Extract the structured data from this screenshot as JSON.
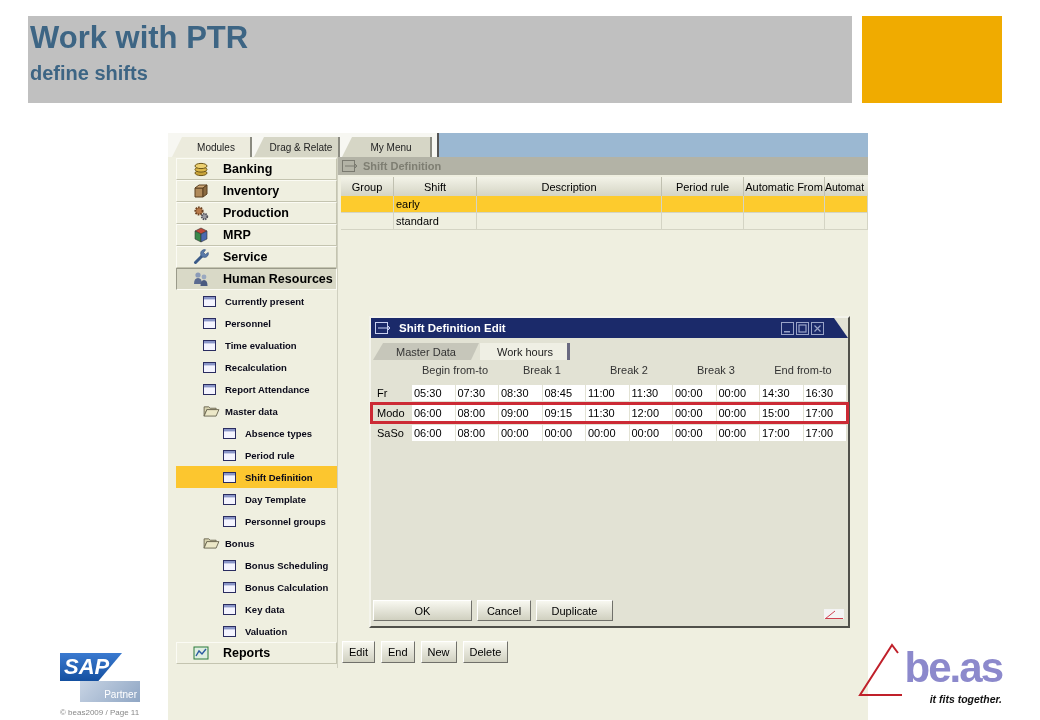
{
  "slide": {
    "title": "Work with PTR",
    "subtitle": "define shifts"
  },
  "sidebar": {
    "tabs": [
      {
        "label": "Modules",
        "selected": true
      },
      {
        "label": "Drag & Relate",
        "selected": false
      },
      {
        "label": "My Menu",
        "selected": false
      }
    ],
    "modules": [
      {
        "label": "Banking",
        "expanded": false
      },
      {
        "label": "Inventory",
        "expanded": false
      },
      {
        "label": "Production",
        "expanded": false
      },
      {
        "label": "MRP",
        "expanded": false
      },
      {
        "label": "Service",
        "expanded": false
      },
      {
        "label": "Human Resources",
        "expanded": true,
        "children": [
          {
            "label": "Currently present",
            "kind": "form",
            "selected": false
          },
          {
            "label": "Personnel",
            "kind": "form",
            "selected": false
          },
          {
            "label": "Time evaluation",
            "kind": "form",
            "selected": false
          },
          {
            "label": "Recalculation",
            "kind": "form",
            "selected": false
          },
          {
            "label": "Report Attendance",
            "kind": "form",
            "selected": false
          },
          {
            "label": "Master data",
            "kind": "folder",
            "selected": false,
            "expanded": true,
            "children": [
              {
                "label": "Absence types",
                "kind": "form",
                "selected": false
              },
              {
                "label": "Period rule",
                "kind": "form",
                "selected": false
              },
              {
                "label": "Shift Definition",
                "kind": "form",
                "selected": true
              },
              {
                "label": "Day Template",
                "kind": "form",
                "selected": false
              },
              {
                "label": "Personnel groups",
                "kind": "form",
                "selected": false
              }
            ]
          },
          {
            "label": "Bonus",
            "kind": "folder",
            "selected": false,
            "expanded": true,
            "children": [
              {
                "label": "Bonus Scheduling",
                "kind": "form",
                "selected": false
              },
              {
                "label": "Bonus Calculation",
                "kind": "form",
                "selected": false
              },
              {
                "label": "Key data",
                "kind": "form",
                "selected": false
              },
              {
                "label": "Valuation",
                "kind": "form",
                "selected": false
              }
            ]
          }
        ]
      },
      {
        "label": "Reports",
        "expanded": false
      }
    ]
  },
  "window": {
    "title": "Shift Definition",
    "active": false,
    "columns": [
      "Group",
      "Shift",
      "Description",
      "Period rule",
      "Automatic From",
      "Automat"
    ],
    "rows": [
      {
        "shift": "early",
        "selected": true
      },
      {
        "shift": "standard",
        "selected": false
      }
    ],
    "buttons": [
      "Edit",
      "End",
      "New",
      "Delete"
    ]
  },
  "dialog": {
    "title": "Shift Definition Edit",
    "active": true,
    "tabs": [
      {
        "label": "Master Data",
        "selected": false
      },
      {
        "label": "Work hours",
        "selected": true
      }
    ],
    "column_groups": [
      "Begin from-to",
      "Break 1",
      "Break 2",
      "Break 3",
      "End from-to"
    ],
    "rows": [
      {
        "day": "Fr",
        "times": [
          "05:30",
          "07:30",
          "08:30",
          "08:45",
          "11:00",
          "11:30",
          "00:00",
          "00:00",
          "14:30",
          "16:30"
        ],
        "highlighted": false
      },
      {
        "day": "Modo",
        "times": [
          "06:00",
          "08:00",
          "09:00",
          "09:15",
          "11:30",
          "12:00",
          "00:00",
          "00:00",
          "15:00",
          "17:00"
        ],
        "highlighted": true
      },
      {
        "day": "SaSo",
        "times": [
          "06:00",
          "08:00",
          "00:00",
          "00:00",
          "00:00",
          "00:00",
          "00:00",
          "00:00",
          "17:00",
          "17:00"
        ],
        "highlighted": false
      }
    ],
    "buttons": [
      "OK",
      "Cancel",
      "Duplicate"
    ]
  },
  "footer": {
    "partner_logo": {
      "name": "SAP",
      "caption": "Partner"
    },
    "copyright": "© beas2009 / Page 11",
    "brand_logo": {
      "name": "be.as",
      "tagline": "it fits together."
    }
  }
}
